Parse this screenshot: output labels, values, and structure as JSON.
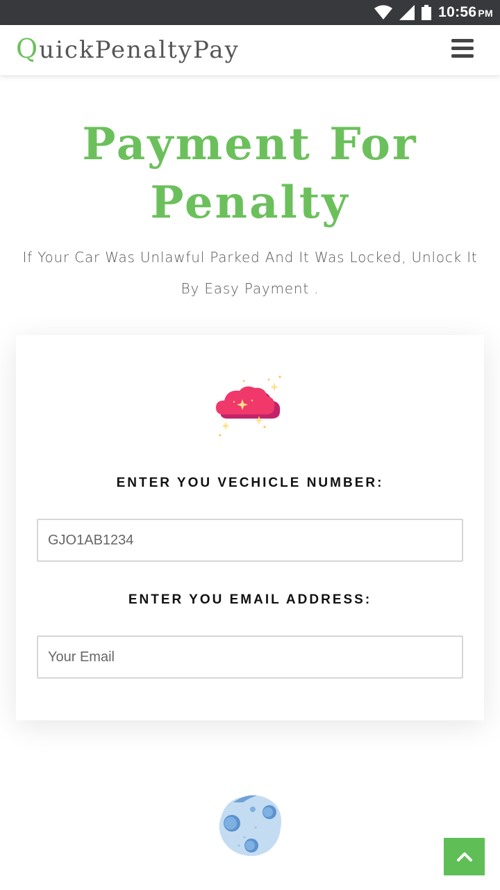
{
  "status_bar": {
    "time": "10:56",
    "ampm": "PM",
    "icons": [
      "wifi-icon",
      "signal-icon",
      "battery-icon"
    ]
  },
  "header": {
    "brand_first": "Q",
    "brand_rest": "uickPenaltyPay",
    "menu_icon": "hamburger-menu-icon"
  },
  "hero": {
    "title_line1": "Payment For",
    "title_line2": "Penalty",
    "subtitle": "If Your Car Was Unlawful Parked And It Was Locked, Unlock It By Easy Payment ."
  },
  "form": {
    "decor_icon": "sparkle-cloud-icon",
    "vehicle_label": "ENTER YOU VECHICLE NUMBER:",
    "vehicle_placeholder": "GJO1AB1234",
    "email_label": "ENTER YOU EMAIL ADDRESS:",
    "email_placeholder": "Your Email"
  },
  "footer": {
    "decor_icon": "moon-icon",
    "back_to_top_icon": "chevron-up-icon"
  },
  "colors": {
    "accent_green": "#6cc05c",
    "status_bar": "#37393d",
    "back_to_top": "#5fbf56",
    "cloud_pink": "#f0386b"
  }
}
